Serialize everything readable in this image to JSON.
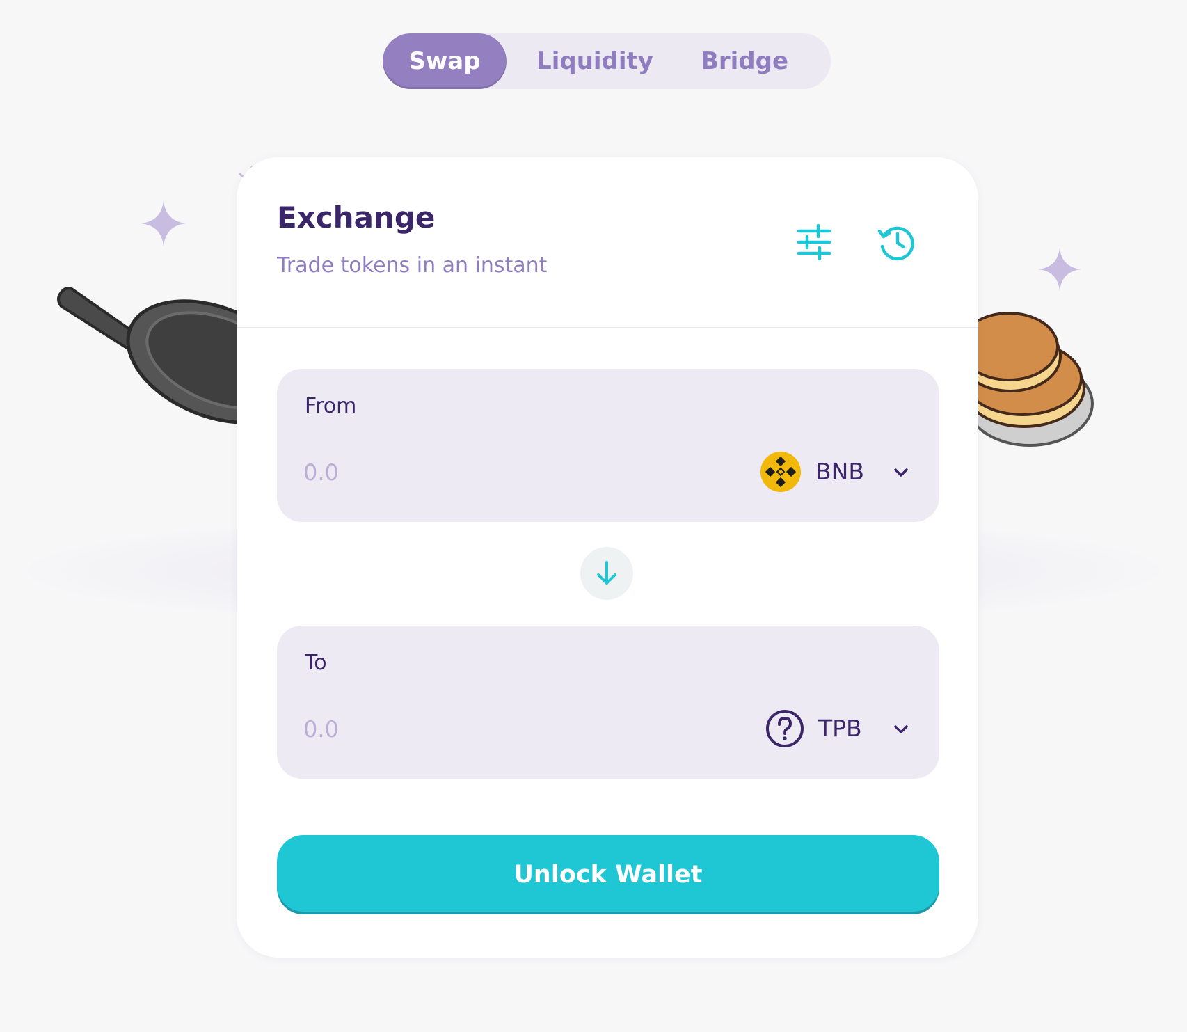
{
  "colors": {
    "primary": "#1fc7d4",
    "secondary": "#9480c1",
    "text": "#3a2669",
    "text_subtle": "#8f7dbf",
    "input_bg": "#eeeaf4",
    "bnb_gold": "#f0b90b"
  },
  "nav": {
    "tabs": [
      {
        "label": "Swap",
        "active": true
      },
      {
        "label": "Liquidity",
        "active": false
      },
      {
        "label": "Bridge",
        "active": false
      }
    ]
  },
  "card": {
    "title": "Exchange",
    "subtitle": "Trade tokens in an instant",
    "icons": {
      "settings": "sliders-icon",
      "history": "history-icon"
    }
  },
  "from": {
    "label": "From",
    "placeholder": "0.0",
    "token": "BNB",
    "token_icon": "bnb-logo-icon"
  },
  "switch": {
    "icon": "arrow-down-icon"
  },
  "to": {
    "label": "To",
    "placeholder": "0.0",
    "token": "TPB",
    "token_icon": "unknown-token-icon"
  },
  "action": {
    "label": "Unlock Wallet"
  }
}
